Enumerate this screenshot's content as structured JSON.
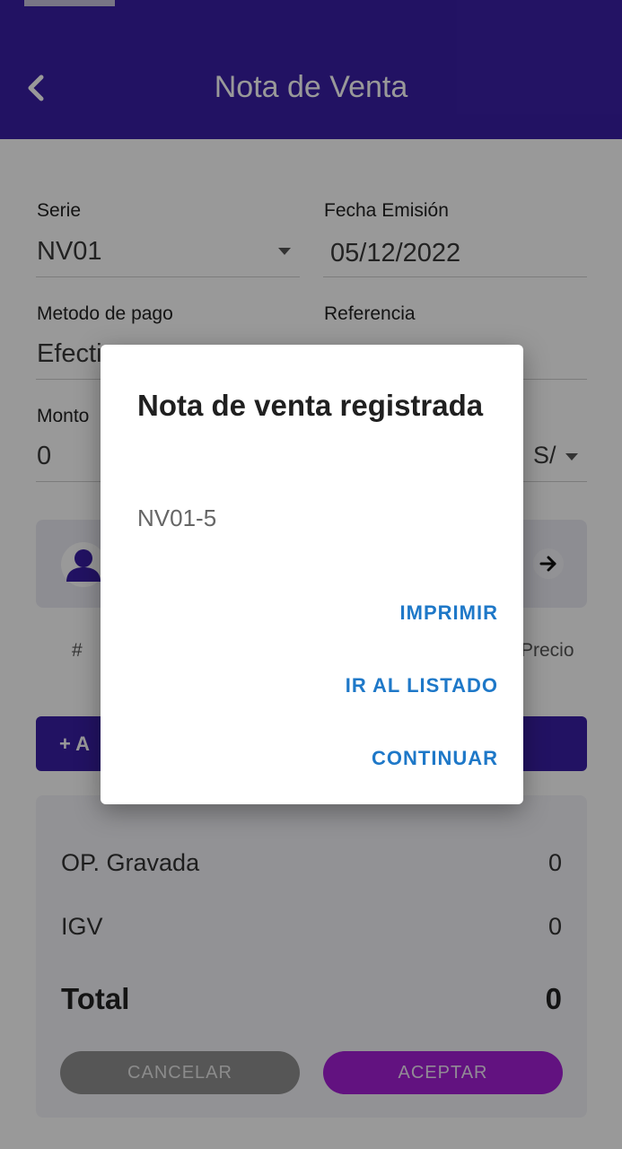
{
  "app_bar": {
    "title": "Nota de Venta"
  },
  "form": {
    "serie": {
      "label": "Serie",
      "value": "NV01"
    },
    "fecha": {
      "label": "Fecha Emisión",
      "value": "05/12/2022"
    },
    "metodo": {
      "label": "Metodo de pago",
      "value": "Efecti"
    },
    "referencia": {
      "label": "Referencia",
      "value": ""
    },
    "monto": {
      "label": "Monto",
      "value": "0"
    },
    "moneda": {
      "value": "S/"
    }
  },
  "items_table": {
    "col_number": "#",
    "col_price": "Precio"
  },
  "add_button": {
    "label": "+ A"
  },
  "totals": {
    "gravada_label": "OP. Gravada",
    "gravada_value": "0",
    "igv_label": "IGV",
    "igv_value": "0",
    "total_label": "Total",
    "total_value": "0"
  },
  "buttons": {
    "cancel": "CANCELAR",
    "accept": "ACEPTAR"
  },
  "dialog": {
    "title": "Nota de venta registrada",
    "message": "NV01-5",
    "actions": [
      "IMPRIMIR",
      "IR AL LISTADO",
      "CONTINUAR"
    ]
  },
  "colors": {
    "primary": "#3a1fa6",
    "accent": "#a41fd6",
    "link": "#1e78c8"
  }
}
